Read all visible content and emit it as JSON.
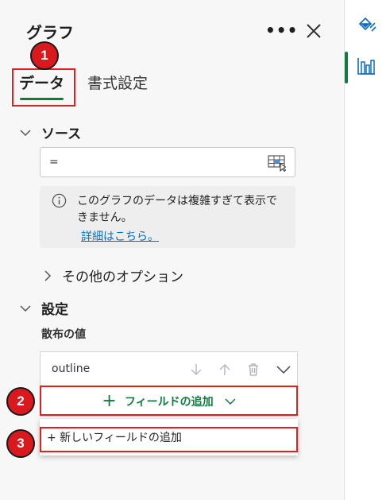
{
  "panel": {
    "title": "グラフ",
    "more_label": "•••",
    "tabs": [
      {
        "label": "データ",
        "active": true
      },
      {
        "label": "書式設定",
        "active": false
      }
    ]
  },
  "source": {
    "header": "ソース",
    "input_value": "=",
    "info_message": "このグラフのデータは複雑すぎて表示できません。",
    "info_link": "詳細はこちら。",
    "more_options": "その他のオプション"
  },
  "settings": {
    "header": "設定",
    "scatter_label": "散布の値",
    "field_name": "outline",
    "add_field_label": "フィールドの追加",
    "dropdown_option": "+ 新しいフィールドの追加"
  },
  "annotations": [
    "1",
    "2",
    "3"
  ],
  "colors": {
    "accent": "#117a3f",
    "link": "#0f6cbd",
    "annotation": "#e0201b"
  },
  "icons": [
    "more-icon",
    "close-icon",
    "chevron-down-icon",
    "chevron-right-icon",
    "range-select-icon",
    "info-icon",
    "arrow-down-icon",
    "arrow-up-icon",
    "delete-icon",
    "plus-icon",
    "paint-format-icon",
    "chart-icon"
  ]
}
